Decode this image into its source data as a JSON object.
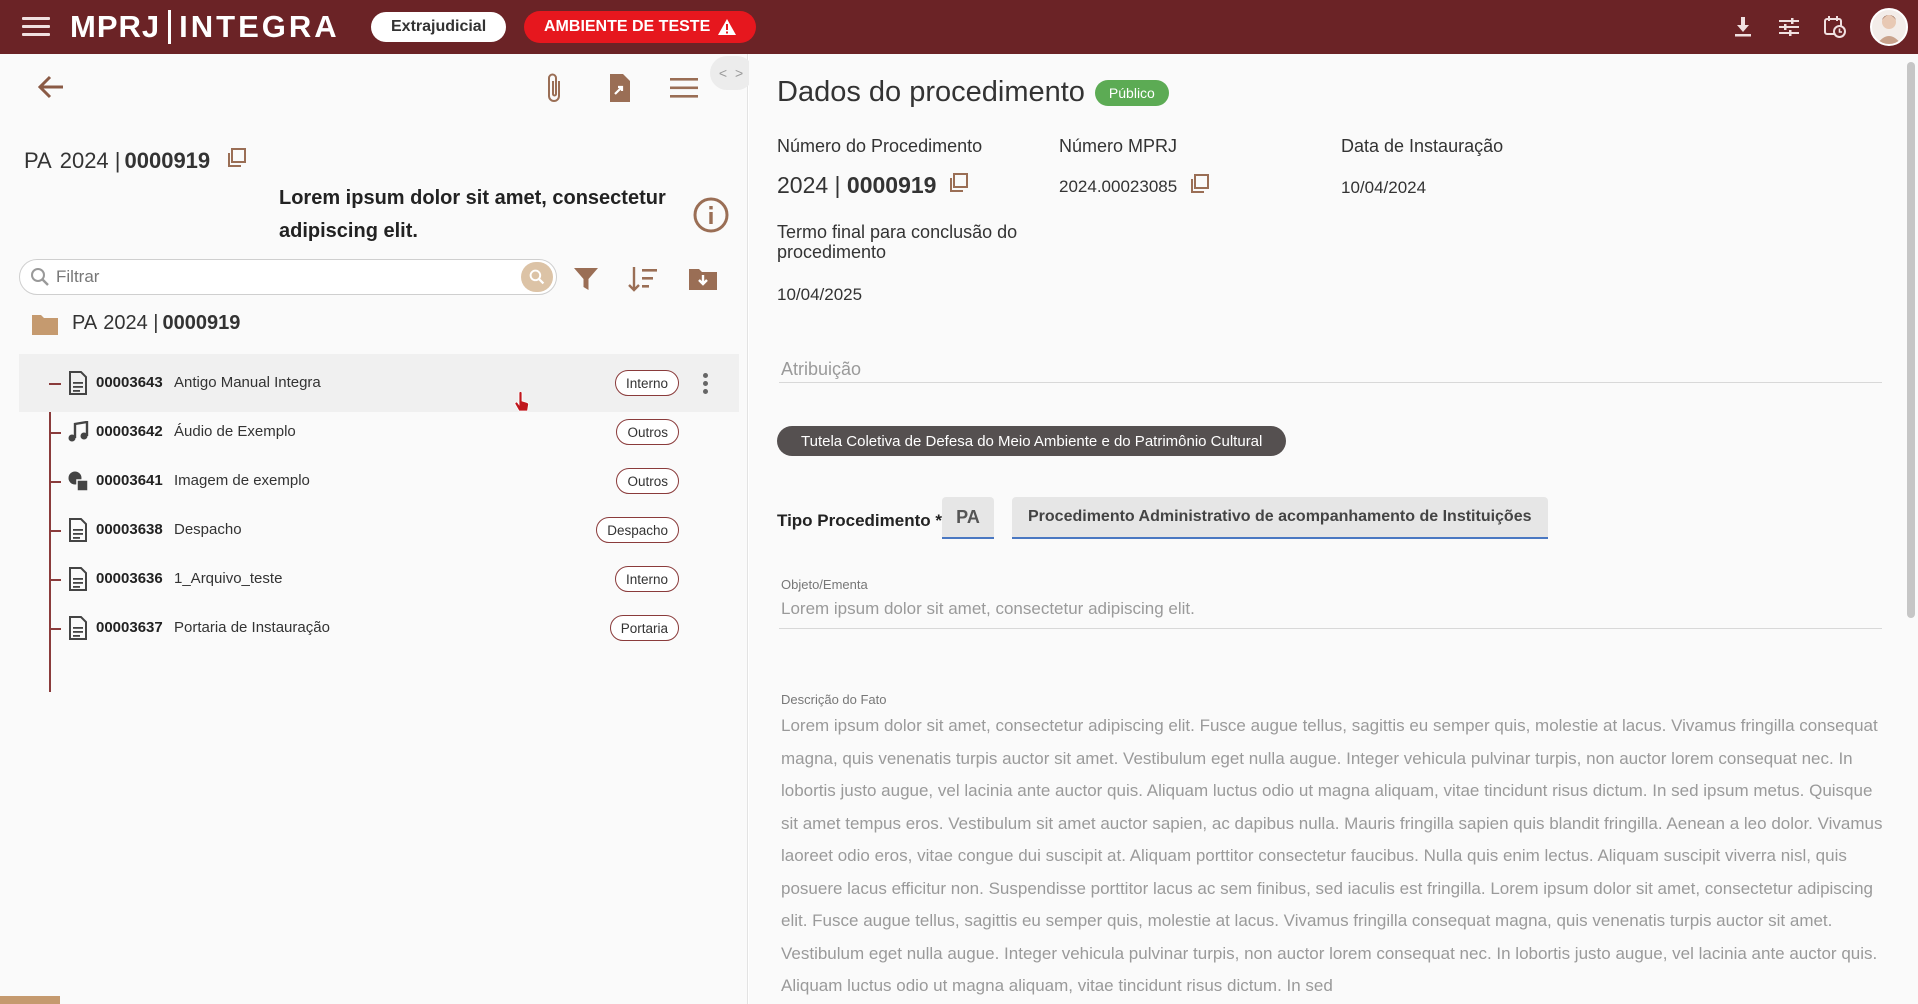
{
  "topbar": {
    "logo_left": "MPRJ",
    "logo_right": "INTEGRA",
    "chip_extrajudicial": "Extrajudicial",
    "chip_ambiente": "AMBIENTE DE TESTE",
    "icons": [
      "download-icon",
      "tune-icon",
      "calendar-clock-icon",
      "avatar"
    ]
  },
  "left": {
    "toggle": "< >",
    "proc": {
      "prefix": "PA",
      "year": "2024 |",
      "number": "0000919"
    },
    "title": "Lorem ipsum dolor sit amet, consectetur adipiscing elit.",
    "search_placeholder": "Filtrar",
    "folder": {
      "prefix": "PA",
      "year": "2024 |",
      "number": "0000919"
    },
    "documents": [
      {
        "number": "00003643",
        "name": "Antigo Manual Integra",
        "tag": "Interno",
        "icon": "document-icon"
      },
      {
        "number": "00003642",
        "name": "Áudio de Exemplo",
        "tag": "Outros",
        "icon": "music-icon"
      },
      {
        "number": "00003641",
        "name": "Imagem de exemplo",
        "tag": "Outros",
        "icon": "shapes-icon"
      },
      {
        "number": "00003638",
        "name": "Despacho",
        "tag": "Despacho",
        "icon": "document-icon"
      },
      {
        "number": "00003636",
        "name": "1_Arquivo_teste",
        "tag": "Interno",
        "icon": "document-icon"
      },
      {
        "number": "00003637",
        "name": "Portaria de Instauração",
        "tag": "Portaria",
        "icon": "document-icon"
      }
    ]
  },
  "right": {
    "title": "Dados do procedimento",
    "badge": "Público",
    "numero_label": "Número do Procedimento",
    "numero_year": "2024 |",
    "numero_value": "0000919",
    "mprj_label": "Número MPRJ",
    "mprj_value": "2024.00023085",
    "instauracao_label": "Data de Instauração",
    "instauracao_value": "10/04/2024",
    "termo_label_1": "Termo final para conclusão do",
    "termo_label_2": "procedimento",
    "termo_value": "10/04/2025",
    "atribuicao_label": "Atribuição",
    "atribuicao_chip": "Tutela Coletiva de Defesa do Meio Ambiente e do Patrimônio Cultural",
    "tipo_label": "Tipo Procedimento *",
    "tipo_code": "PA",
    "tipo_desc": "Procedimento Administrativo de acompanhamento de Instituições",
    "objeto_label": "Objeto/Ementa",
    "objeto_value": "Lorem ipsum dolor sit amet, consectetur adipiscing elit.",
    "descricao_label": "Descrição do Fato",
    "descricao_value": "Lorem ipsum dolor sit amet, consectetur adipiscing elit. Fusce augue tellus, sagittis eu semper quis, molestie at lacus. Vivamus fringilla consequat magna, quis venenatis turpis auctor sit amet. Vestibulum eget nulla augue. Integer vehicula pulvinar turpis, non auctor lorem consequat nec. In lobortis justo augue, vel lacinia ante auctor quis. Aliquam luctus odio ut magna aliquam, vitae tincidunt risus dictum. In sed ipsum metus. Quisque sit amet tempus eros. Vestibulum sit amet auctor sapien, ac dapibus nulla. Mauris fringilla sapien quis blandit fringilla. Aenean a leo dolor. Vivamus laoreet odio eros, vitae congue dui suscipit at. Aliquam porttitor consectetur faucibus. Nulla quis enim lectus. Aliquam suscipit viverra nisl, quis posuere lacus efficitur non. Suspendisse porttitor lacus ac sem finibus, sed iaculis est fringilla. Lorem ipsum dolor sit amet, consectetur adipiscing elit. Fusce augue tellus, sagittis eu semper quis, molestie at lacus. Vivamus fringilla consequat magna, quis venenatis turpis auctor sit amet. Vestibulum eget nulla augue. Integer vehicula pulvinar turpis, non auctor lorem consequat nec. In lobortis justo augue, vel lacinia ante auctor quis. Aliquam luctus odio ut magna aliquam, vitae tincidunt risus dictum. In sed"
  },
  "colors": {
    "topbar": "#6b2326",
    "accent": "#8a3b3b",
    "test_red": "#e6171e",
    "public_green": "#5cab54",
    "folder": "#c59a6f"
  }
}
